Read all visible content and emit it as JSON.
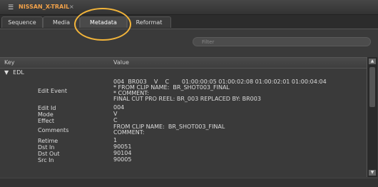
{
  "window": {
    "title": "NISSAN_X-TRAIL",
    "menu_icon": "menu-icon",
    "close_icon": "close-icon",
    "close_glyph": "×"
  },
  "tabs": [
    {
      "label": "Sequence",
      "active": false
    },
    {
      "label": "Media",
      "active": false
    },
    {
      "label": "Metadata",
      "active": true
    },
    {
      "label": "Reformat",
      "active": false
    }
  ],
  "filter": {
    "placeholder": "Filter",
    "value": ""
  },
  "table": {
    "headers": {
      "key": "Key",
      "value": "Value"
    },
    "group": "EDL",
    "rows": [
      {
        "key": "Edit Event",
        "value": "004  BR003    V    C       01:00:00:05 01:00:02:08 01:00:02:01 01:00:04:04\n* FROM CLIP NAME:  BR_SHOT003_FINAL\n* COMMENT:\nFINAL CUT PRO REEL: BR_003 REPLACED BY: BR003"
      },
      {
        "key": "Edit Id",
        "value": "004"
      },
      {
        "key": "Mode",
        "value": "V"
      },
      {
        "key": "Effect",
        "value": "C"
      },
      {
        "key": "Comments",
        "value": "FROM CLIP NAME:  BR_SHOT003_FINAL\nCOMMENT:"
      },
      {
        "key": "Retime",
        "value": "1"
      },
      {
        "key": "Dst In",
        "value": "90051"
      },
      {
        "key": "Dst Out",
        "value": "90104"
      },
      {
        "key": "Src In",
        "value": "90005"
      }
    ]
  },
  "annotation_color": "#f2b43a"
}
